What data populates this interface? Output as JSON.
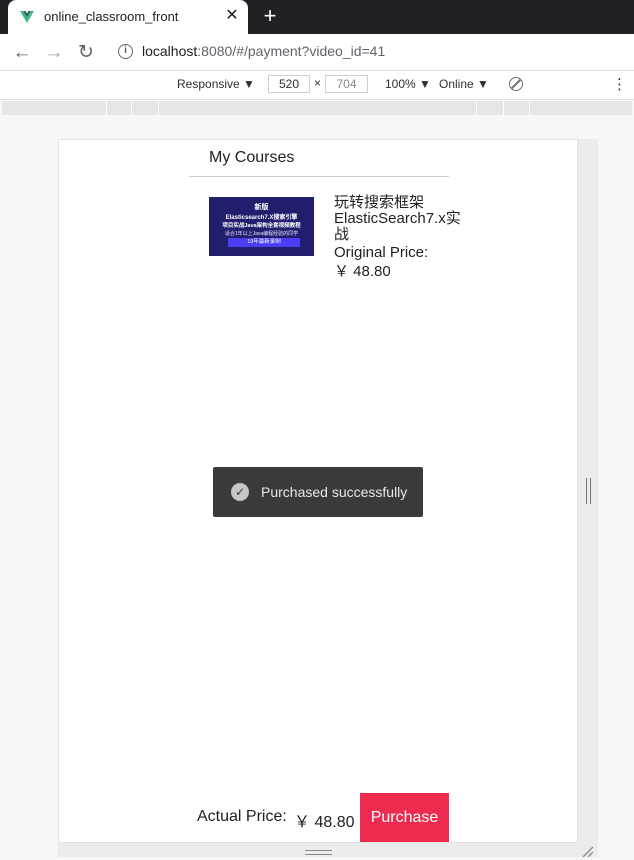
{
  "browser": {
    "tab_title": "online_classroom_front",
    "tab_close": "✕",
    "new_tab": "+",
    "url_host": "localhost",
    "url_rest": ":8080/#/payment?video_id=41"
  },
  "devtools": {
    "device": "Responsive ▼",
    "width": "520",
    "times": "×",
    "height": "704",
    "zoom": "100% ▼",
    "network": "Online ▼",
    "menu": "⋮"
  },
  "page": {
    "header_title": "My Courses",
    "course": {
      "thumbnail": {
        "line1": "新版",
        "line2": "Elasticsearch7.X搜索引擎",
        "line3": "项目实战Java架构全套视频教程",
        "line4": "适合1年以上Java编程经验的同学",
        "line5": "19年最新录制"
      },
      "title": "玩转搜索框架ElasticSearch7.x实战",
      "original_price_label": "Original Price:",
      "original_price": "￥ 48.80"
    },
    "toast": {
      "icon": "✓",
      "message": "Purchased successfully"
    },
    "footer": {
      "actual_price_label": "Actual Price:",
      "actual_price": "￥ 48.80",
      "purchase_label": "Purchase"
    }
  },
  "colors": {
    "purchase_button": "#ee2a4f",
    "toast_background": "#3a3a3c",
    "vue_logo": "#41b883"
  }
}
